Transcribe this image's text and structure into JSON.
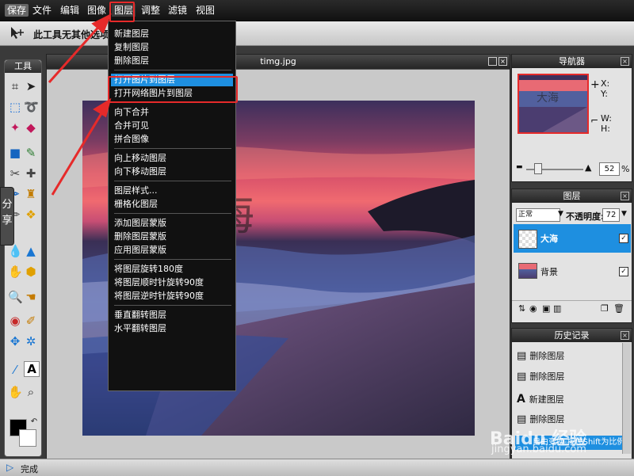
{
  "menubar": {
    "items": [
      "保存",
      "文件",
      "编辑",
      "图像",
      "图层",
      "调整",
      "滤镜",
      "视图"
    ],
    "active": "图层"
  },
  "options": {
    "message": "此工具无其他选项"
  },
  "tools_panel": {
    "title": "工具"
  },
  "share_tab": {
    "label": "分享"
  },
  "canvas": {
    "title": "timg.jpg",
    "text_layer": "大海"
  },
  "layer_menu": {
    "groups": [
      [
        "新建图层",
        "复制图层",
        "删除图层"
      ],
      [
        "打开图片到图层",
        "打开网络图片到图层"
      ],
      [
        "向下合并",
        "合并可见",
        "拼合图像"
      ],
      [
        "向上移动图层",
        "向下移动图层"
      ],
      [
        "图层样式...",
        "栅格化图层"
      ],
      [
        "添加图层蒙版",
        "删除图层蒙版",
        "应用图层蒙版"
      ],
      [
        "将图层旋转180度",
        "将图层顺时针旋转90度",
        "将图层逆时针旋转90度"
      ],
      [
        "垂直翻转图层",
        "水平翻转图层"
      ]
    ],
    "highlighted": "打开图片到图层"
  },
  "navigator": {
    "title": "导航器",
    "thumb_text": "大海",
    "x_label": "X:",
    "y_label": "Y:",
    "w_label": "W:",
    "h_label": "H:",
    "zoom": "52",
    "zoom_unit": "%"
  },
  "layers_panel": {
    "title": "图层",
    "blend_mode": "正常",
    "opacity_label": "不透明度:",
    "opacity": "72",
    "layers": [
      {
        "name": "大海",
        "selected": true,
        "visible": true
      },
      {
        "name": "背景",
        "selected": false,
        "visible": true
      }
    ]
  },
  "history_panel": {
    "title": "历史记录",
    "items": [
      "删除图层",
      "删除图层",
      "新建图层",
      "删除图层"
    ],
    "tip": "自由变换-按住Shift为比例缩"
  },
  "status": {
    "text": "完成"
  },
  "watermark": {
    "brand": "Baidu 经验",
    "url": "jingyan.baidu.com"
  },
  "colors": {
    "accent": "#1e8fe0",
    "annotation": "#e62a2a",
    "foreground": "#000000",
    "background": "#ffffff"
  }
}
